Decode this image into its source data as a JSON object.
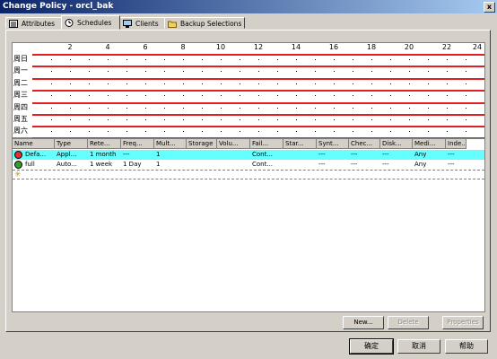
{
  "window": {
    "title": "Change Policy - orcl_bak",
    "close_label": "x"
  },
  "tabs": [
    {
      "label": "Attributes",
      "icon": "attributes-icon"
    },
    {
      "label": "Schedules",
      "icon": "schedules-icon"
    },
    {
      "label": "Clients",
      "icon": "clients-icon"
    },
    {
      "label": "Backup Selections",
      "icon": "folder-icon"
    }
  ],
  "schedule_grid": {
    "hour_labels": [
      "2",
      "4",
      "6",
      "8",
      "10",
      "12",
      "14",
      "16",
      "18",
      "20",
      "22",
      "24"
    ],
    "days": [
      "周日",
      "周一",
      "周二",
      "周三",
      "周四",
      "周五",
      "周六"
    ]
  },
  "table": {
    "columns": [
      "Name",
      "Type",
      "Rete...",
      "Freq...",
      "Mult...",
      "Storage",
      "Volu...",
      "Fail...",
      "Star...",
      "Synt...",
      "Chec...",
      "Disk...",
      "Medi...",
      "Inde..."
    ],
    "rows": [
      {
        "icon": "default-schedule-icon",
        "icon_color": "#e03030",
        "selected": true,
        "cells": [
          "Defa...",
          "Appl...",
          "1 month",
          "---",
          "1",
          "",
          "",
          "Cont...",
          "",
          "---",
          "---",
          "---",
          "Any",
          "---"
        ]
      },
      {
        "icon": "full-schedule-icon",
        "icon_color": "#30a030",
        "selected": false,
        "cells": [
          "full",
          "Auto...",
          "1 week",
          "1 Day",
          "1",
          "",
          "",
          "Cont...",
          "",
          "---",
          "---",
          "---",
          "Any",
          "---"
        ]
      }
    ],
    "new_row_icon": "new-item-icon"
  },
  "buttons": {
    "new": "New...",
    "delete": "Delete",
    "properties": "Properties",
    "ok": "确定",
    "cancel": "取消",
    "help": "帮助"
  },
  "colors": {
    "selection": "#66ffff",
    "schedule_line": "#e02020",
    "title_bar": "#0a246a"
  }
}
